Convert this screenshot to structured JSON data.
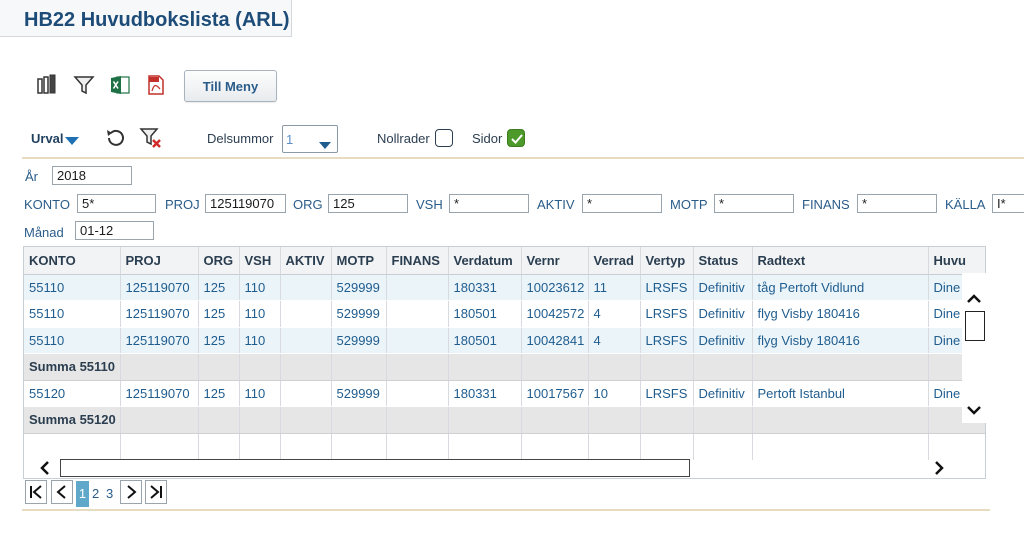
{
  "page": {
    "title": "HB22 Huvudbokslista (ARL)"
  },
  "toolbar": {
    "columns_icon": "columns-icon",
    "filter_icon": "filter-icon",
    "excel_icon": "excel-icon",
    "pdf_icon": "pdf-icon",
    "menu_button": "Till Meny"
  },
  "options": {
    "urval_label": "Urval",
    "delsummor_label": "Delsummor",
    "delsummor_value": "1",
    "nollrader_label": "Nollrader",
    "nollrader_checked": false,
    "sidor_label": "Sidor",
    "sidor_checked": true,
    "colors": {
      "checked": "#4d9a2a",
      "divider": "#e7dcc2"
    }
  },
  "filters": {
    "ar": {
      "label": "År",
      "value": "2018"
    },
    "konto": {
      "label": "KONTO",
      "value": "5*"
    },
    "proj": {
      "label": "PROJ",
      "value": "125119070"
    },
    "org": {
      "label": "ORG",
      "value": "125"
    },
    "vsh": {
      "label": "VSH",
      "value": "*"
    },
    "aktiv": {
      "label": "AKTIV",
      "value": "*"
    },
    "motp": {
      "label": "MOTP",
      "value": "*"
    },
    "finans": {
      "label": "FINANS",
      "value": "*"
    },
    "kalla": {
      "label": "KÄLLA",
      "value": "I*"
    },
    "manad": {
      "label": "Månad",
      "value": "01-12"
    }
  },
  "grid": {
    "columns": [
      "KONTO",
      "PROJ",
      "ORG",
      "VSH",
      "AKTIV",
      "MOTP",
      "FINANS",
      "Verdatum",
      "Vernr",
      "Verrad",
      "Vertyp",
      "Status",
      "Radtext",
      "Huvu"
    ],
    "rows": [
      {
        "type": "data",
        "cells": [
          "55110",
          "125119070",
          "125",
          "110",
          "",
          "529999",
          "",
          "180331",
          "10023612",
          "11",
          "LRSFS",
          "Definitiv",
          "tåg Pertoft Vidlund",
          "Dine"
        ]
      },
      {
        "type": "data",
        "cells": [
          "55110",
          "125119070",
          "125",
          "110",
          "",
          "529999",
          "",
          "180501",
          "10042572",
          "4",
          "LRSFS",
          "Definitiv",
          "flyg Visby 180416",
          "Dine"
        ]
      },
      {
        "type": "data",
        "cells": [
          "55110",
          "125119070",
          "125",
          "110",
          "",
          "529999",
          "",
          "180501",
          "10042841",
          "4",
          "LRSFS",
          "Definitiv",
          "flyg Visby 180416",
          "Dine"
        ]
      },
      {
        "type": "sum",
        "cells": [
          "Summa 55110",
          "",
          "",
          "",
          "",
          "",
          "",
          "",
          "",
          "",
          "",
          "",
          "",
          ""
        ]
      },
      {
        "type": "data",
        "cells": [
          "55120",
          "125119070",
          "125",
          "110",
          "",
          "529999",
          "",
          "180331",
          "10017567",
          "10",
          "LRSFS",
          "Definitiv",
          "Pertoft Istanbul",
          "Dine"
        ]
      },
      {
        "type": "sum",
        "cells": [
          "Summa 55120",
          "",
          "",
          "",
          "",
          "",
          "",
          "",
          "",
          "",
          "",
          "",
          "",
          ""
        ]
      },
      {
        "type": "empty",
        "cells": [
          "",
          "",
          "",
          "",
          "",
          "",
          "",
          "",
          "",
          "",
          "",
          "",
          "",
          ""
        ]
      }
    ]
  },
  "pager": {
    "pages": [
      "1",
      "2",
      "3"
    ],
    "current": "1"
  }
}
